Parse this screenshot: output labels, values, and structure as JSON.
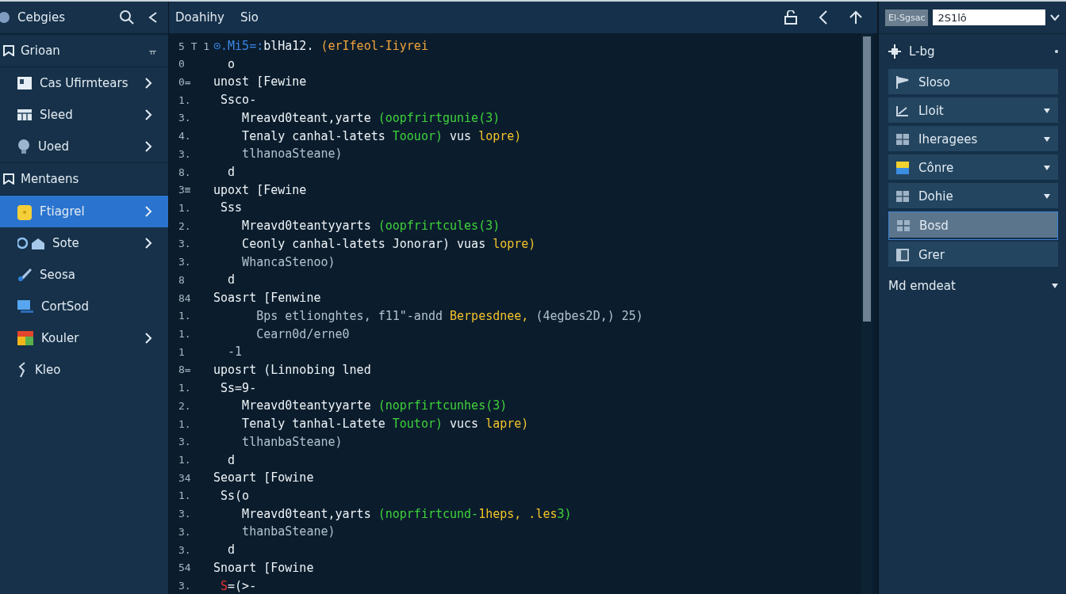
{
  "sidebar": {
    "title": "Cebgies",
    "groups": [
      {
        "label": "Grioan",
        "badge": "ㅠ",
        "items": [
          {
            "label": "Cas  Ufirmtears",
            "expandable": true,
            "selected": false
          },
          {
            "label": "Sleed",
            "expandable": true,
            "selected": false
          },
          {
            "label": "Uoed",
            "expandable": true,
            "selected": false
          }
        ]
      },
      {
        "label": "Mentaens",
        "items": [
          {
            "label": "Ftiagrel",
            "expandable": true,
            "selected": true
          },
          {
            "label": "Sote",
            "expandable": true,
            "selected": false
          },
          {
            "label": "Seosa",
            "expandable": false,
            "selected": false
          },
          {
            "label": "CortSod",
            "expandable": false,
            "selected": false
          },
          {
            "label": "Kouler",
            "expandable": true,
            "selected": false
          },
          {
            "label": "Kleo",
            "expandable": false,
            "selected": false
          }
        ]
      }
    ]
  },
  "editor": {
    "tabs": [
      "Doahihy",
      "Sio"
    ],
    "lines": [
      {
        "num": "5 T 1",
        "segs": [
          {
            "t": "⊙.Mi5=:",
            "color": "#3a87e8"
          },
          {
            "t": "blHa12. ",
            "color": "#eef3f7"
          },
          {
            "t": "(erIfeol-Iiyrei",
            "color": "#f2a33a"
          }
        ]
      },
      {
        "num": "0",
        "segs": [
          {
            "t": "  o",
            "color": "#eef3f7"
          }
        ]
      },
      {
        "num": "0=",
        "segs": [
          {
            "t": "unost [Fewine",
            "color": "#eef3f7"
          }
        ]
      },
      {
        "num": "1.",
        "segs": [
          {
            "t": " Ssco-",
            "color": "#eef3f7"
          }
        ]
      },
      {
        "num": "3.",
        "segs": [
          {
            "t": "    Mreavd0teant,yarte ",
            "color": "#eef3f7"
          },
          {
            "t": "(oopfrirtgunie(3)",
            "color": "#3fd33a"
          }
        ]
      },
      {
        "num": "4.",
        "segs": [
          {
            "t": "    Tenaly canhal-latets ",
            "color": "#eef3f7"
          },
          {
            "t": "Toouor)",
            "color": "#3fd33a"
          },
          {
            "t": " vus ",
            "color": "#eef3f7"
          },
          {
            "t": "lopre)",
            "color": "#f3c32a"
          }
        ]
      },
      {
        "num": "3.",
        "segs": [
          {
            "t": "    tlhanoaSteane)",
            "color": "#b3c1cd"
          }
        ]
      },
      {
        "num": "8.",
        "segs": [
          {
            "t": "  d",
            "color": "#eef3f7"
          }
        ]
      },
      {
        "num": "3≡",
        "segs": [
          {
            "t": "upoxt [Fewine",
            "color": "#eef3f7"
          }
        ]
      },
      {
        "num": "1.",
        "segs": [
          {
            "t": " Sss",
            "color": "#eef3f7"
          }
        ]
      },
      {
        "num": "2.",
        "segs": [
          {
            "t": "    Mreavd0teantyyarts ",
            "color": "#eef3f7"
          },
          {
            "t": "(oopfrirtcules(3)",
            "color": "#3fd33a"
          }
        ]
      },
      {
        "num": "3.",
        "segs": [
          {
            "t": "    Ceonly canhal-latets Jonorar) vuas ",
            "color": "#eef3f7"
          },
          {
            "t": "lopre)",
            "color": "#f3c32a"
          }
        ]
      },
      {
        "num": "3.",
        "segs": [
          {
            "t": "    WhancaStenoo)",
            "color": "#b3c1cd"
          }
        ]
      },
      {
        "num": "8",
        "segs": [
          {
            "t": "  d",
            "color": "#eef3f7"
          }
        ]
      },
      {
        "num": "84",
        "segs": [
          {
            "t": "Soasrt [Fenwine",
            "color": "#eef3f7"
          }
        ]
      },
      {
        "num": "1.",
        "segs": [
          {
            "t": "      Bps etlionghtes, f11\"-andd ",
            "color": "#b3c1cd"
          },
          {
            "t": "Berpesdnee,",
            "color": "#f3c32a"
          },
          {
            "t": " (4egbes2D,) 25)",
            "color": "#b3c1cd"
          }
        ]
      },
      {
        "num": "1.",
        "segs": [
          {
            "t": "      Cearn0d/erne0",
            "color": "#b3c1cd"
          }
        ]
      },
      {
        "num": "1",
        "segs": [
          {
            "t": "  -1",
            "color": "#b3c1cd"
          }
        ]
      },
      {
        "num": "8=",
        "segs": [
          {
            "t": "uposrt (Linnobing lned",
            "color": "#eef3f7"
          }
        ]
      },
      {
        "num": "1.",
        "segs": [
          {
            "t": " Ss=9-",
            "color": "#eef3f7"
          }
        ]
      },
      {
        "num": "2.",
        "segs": [
          {
            "t": "    Mreavd0teantyyarte ",
            "color": "#eef3f7"
          },
          {
            "t": "(noprfirtcunhes(3)",
            "color": "#3fd33a"
          }
        ]
      },
      {
        "num": "1.",
        "segs": [
          {
            "t": "    Tenaly tanhal-Latete ",
            "color": "#eef3f7"
          },
          {
            "t": "Toutor)",
            "color": "#3fd33a"
          },
          {
            "t": " vucs ",
            "color": "#eef3f7"
          },
          {
            "t": "lapre)",
            "color": "#f3c32a"
          }
        ]
      },
      {
        "num": "3.",
        "segs": [
          {
            "t": "    tlhanbaSteane)",
            "color": "#b3c1cd"
          }
        ]
      },
      {
        "num": "1.",
        "segs": [
          {
            "t": "  d",
            "color": "#eef3f7"
          }
        ]
      },
      {
        "num": "34",
        "segs": [
          {
            "t": "Seoart [Fowine",
            "color": "#eef3f7"
          }
        ]
      },
      {
        "num": "1.",
        "segs": [
          {
            "t": " Ss(o",
            "color": "#eef3f7"
          }
        ]
      },
      {
        "num": "3.",
        "segs": [
          {
            "t": "    Mreavd0teant,yarts ",
            "color": "#eef3f7"
          },
          {
            "t": "(noprfirtcund-",
            "color": "#3fd33a"
          },
          {
            "t": "1heps, .les",
            "color": "#f3c32a"
          },
          {
            "t": "3)",
            "color": "#3fd33a"
          }
        ]
      },
      {
        "num": "3.",
        "segs": [
          {
            "t": "    thanbaSteane)",
            "color": "#b3c1cd"
          }
        ]
      },
      {
        "num": "3.",
        "segs": [
          {
            "t": "  d",
            "color": "#eef3f7"
          }
        ]
      },
      {
        "num": "54",
        "segs": [
          {
            "t": "Snoart [Fowine",
            "color": "#eef3f7"
          }
        ]
      },
      {
        "num": "3.",
        "segs": [
          {
            "t": " S",
            "color": "#e8322c"
          },
          {
            "t": "=(>-",
            "color": "#eef3f7"
          }
        ]
      }
    ]
  },
  "panel": {
    "button": "El-Sgsac",
    "field_value": "2S1lô",
    "header": "L-bg",
    "items": [
      {
        "label": "Sloso",
        "dropdown": false,
        "selected": false
      },
      {
        "label": "Lloit",
        "dropdown": true,
        "selected": false
      },
      {
        "label": "Iheragees",
        "dropdown": true,
        "selected": false
      },
      {
        "label": "Cônre",
        "dropdown": true,
        "selected": false
      },
      {
        "label": "Dohie",
        "dropdown": true,
        "selected": false
      },
      {
        "label": "Bosd",
        "dropdown": false,
        "selected": true
      },
      {
        "label": "Grer",
        "dropdown": false,
        "selected": false
      }
    ],
    "footer": "Md emdeat"
  }
}
